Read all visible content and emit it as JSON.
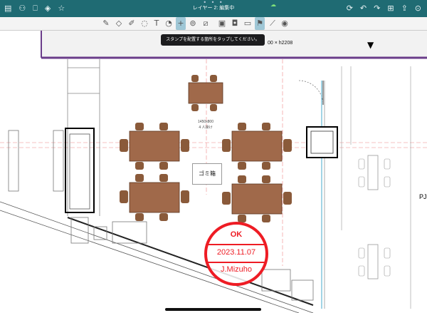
{
  "app": {
    "title": "レイヤー 2: 編集中",
    "top_left_icons": [
      "sidebar-icon",
      "users-icon",
      "book-icon",
      "layers-icon",
      "star-icon"
    ],
    "top_right_icons": [
      "sync-icon",
      "undo-icon",
      "redo-icon",
      "add-page-icon",
      "share-icon",
      "more-icon"
    ]
  },
  "toolbar": {
    "tools": [
      "pen-icon",
      "eraser-icon",
      "marker-icon",
      "lasso-icon",
      "shape-icon",
      "text-icon",
      "select-icon",
      "plus-icon",
      "stamp-circle-icon",
      "ruler-icon",
      "image-icon",
      "camera-icon",
      "folder-icon",
      "stamp-icon",
      "brush-icon",
      "palette-icon"
    ],
    "active_tool": "stamp-icon"
  },
  "toast": {
    "text": "スタンプを配置する箇所をタップしてください。"
  },
  "drawing": {
    "dimension_label": "00 × h2208",
    "table_size_label": "1450x800",
    "table_seats_label": "4 人掛け",
    "trash_label": "ゴミ箱",
    "pj_label": "PJ"
  },
  "stamp": {
    "top": "OK",
    "date": "2023.11.07",
    "name": "J.Mizuho",
    "color": "#ee1c24"
  },
  "colors": {
    "header": "#1f6b73",
    "accent": "#ee1c24",
    "table": "#a0694a"
  }
}
